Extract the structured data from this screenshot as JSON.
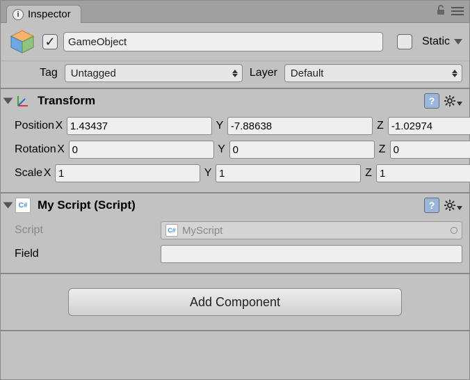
{
  "tab": {
    "title": "Inspector"
  },
  "header": {
    "enabled_check": "✓",
    "name": "GameObject",
    "static_label": "Static"
  },
  "taglayer": {
    "tag_label": "Tag",
    "tag_value": "Untagged",
    "layer_label": "Layer",
    "layer_value": "Default"
  },
  "transform": {
    "title": "Transform",
    "position_label": "Position",
    "rotation_label": "Rotation",
    "scale_label": "Scale",
    "axes": {
      "x": "X",
      "y": "Y",
      "z": "Z"
    },
    "position": {
      "x": "1.43437",
      "y": "-7.88638",
      "z": "-1.02974"
    },
    "rotation": {
      "x": "0",
      "y": "0",
      "z": "0"
    },
    "scale": {
      "x": "1",
      "y": "1",
      "z": "1"
    }
  },
  "myscript": {
    "title": "My Script (Script)",
    "script_label": "Script",
    "script_value": "MyScript",
    "field_label": "Field"
  },
  "add_component": {
    "label": "Add Component"
  }
}
